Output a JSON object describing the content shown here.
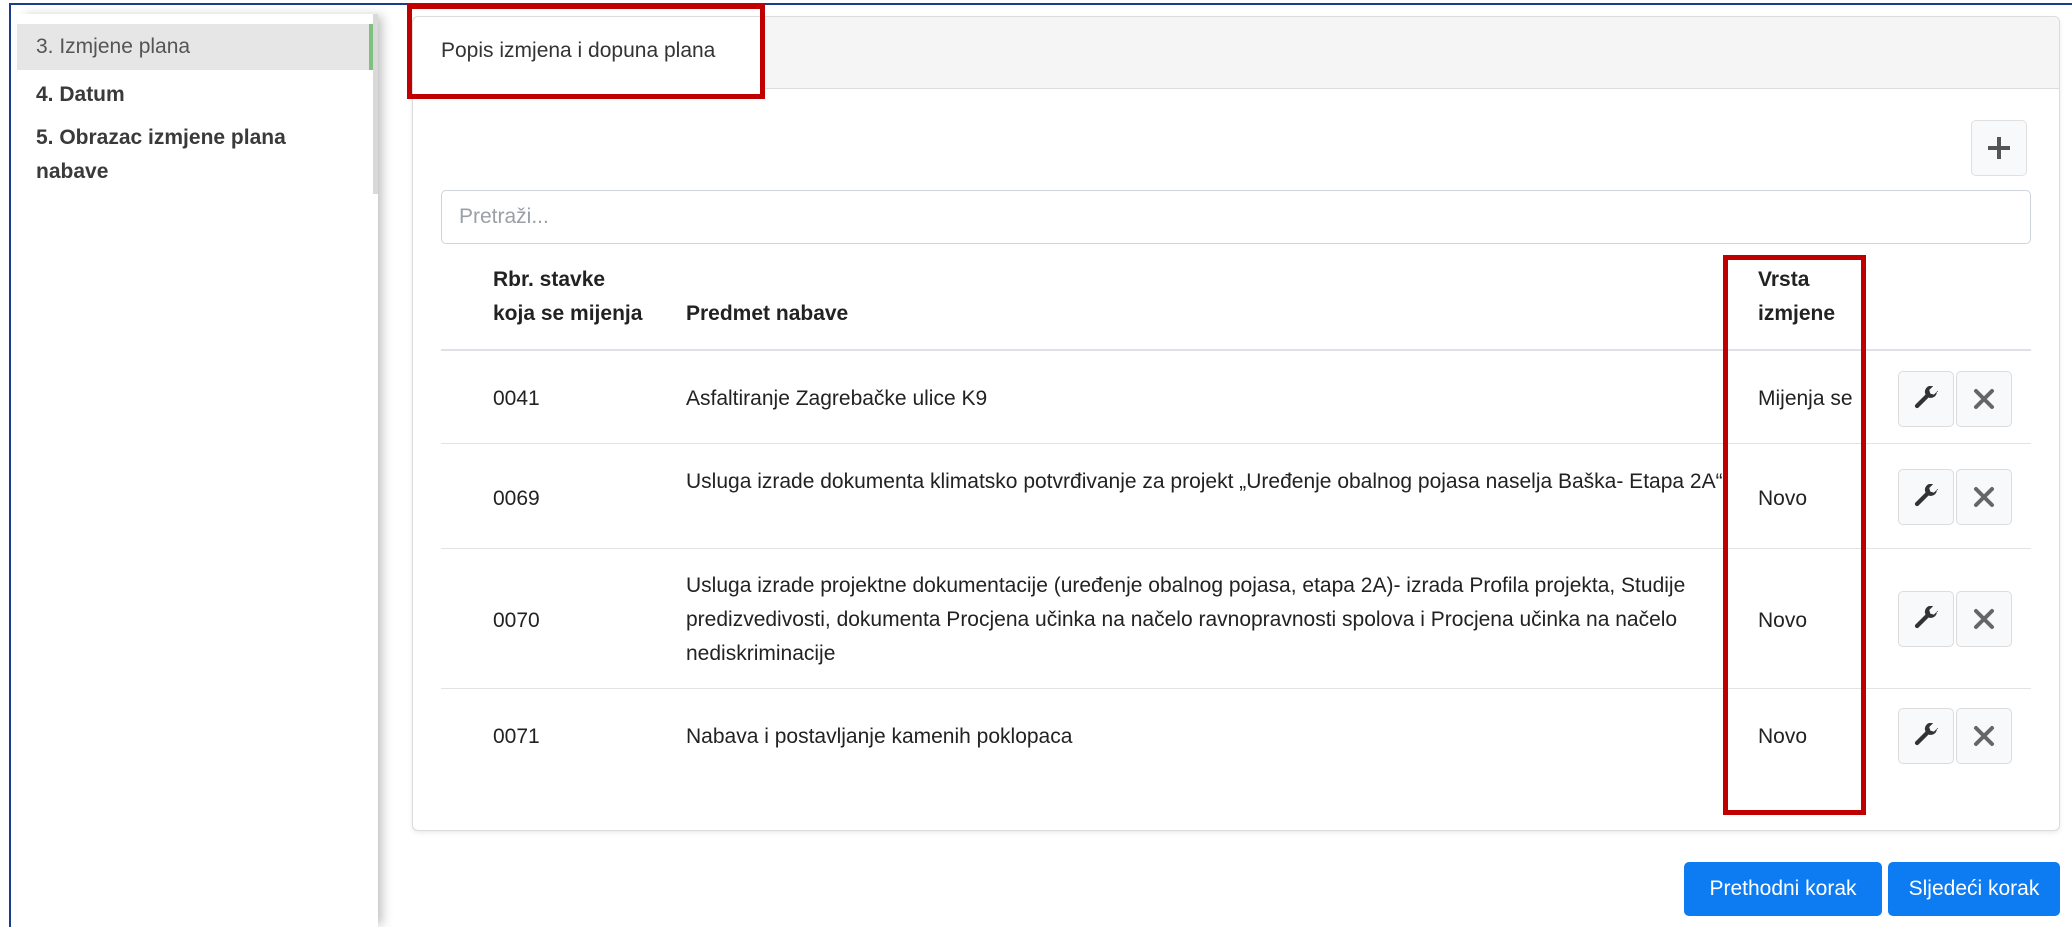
{
  "sidebar": {
    "items": [
      {
        "label": "3. Izmjene plana",
        "active": true
      },
      {
        "label": "4. Datum",
        "active": false
      },
      {
        "label": "5. Obrazac izmjene plana nabave",
        "active": false
      }
    ]
  },
  "card": {
    "tab_label": "Popis izmjena i dopuna plana",
    "add_button_icon": "plus-icon"
  },
  "search": {
    "placeholder": "Pretraži..."
  },
  "table": {
    "columns": {
      "rbr_line1": "Rbr. stavke",
      "rbr_line2": "koja se mijenja",
      "predmet": "Predmet nabave",
      "vrsta_line1": "Vrsta",
      "vrsta_line2": "izmjene"
    },
    "rows": [
      {
        "rbr": "0041",
        "predmet": "Asfaltiranje Zagrebačke ulice K9",
        "vrsta": "Mijenja se"
      },
      {
        "rbr": "0069",
        "predmet": "Usluga izrade dokumenta klimatsko potvrđivanje za projekt „Uređenje obalnog pojasa naselja Baška- Etapa 2A“",
        "vrsta": "Novo"
      },
      {
        "rbr": "0070",
        "predmet": "Usluga izrade projektne dokumentacije (uređenje obalnog pojasa, etapa 2A)- izrada Profila projekta, Studije predizvedivosti, dokumenta Procjena učinka na načelo ravnopravnosti spolova i Procjena učinka na načelo nediskriminacije",
        "vrsta": "Novo"
      },
      {
        "rbr": "0071",
        "predmet": "Nabava i postavljanje kamenih poklopaca",
        "vrsta": "Novo"
      }
    ],
    "action_icons": [
      "wrench-icon",
      "close-icon"
    ]
  },
  "footer": {
    "prev_label": "Prethodni korak",
    "next_label": "Sljedeći korak"
  },
  "colors": {
    "primary": "#0d7bf2",
    "annotation_red": "#c00000",
    "active_indicator": "#7fbf7f"
  }
}
